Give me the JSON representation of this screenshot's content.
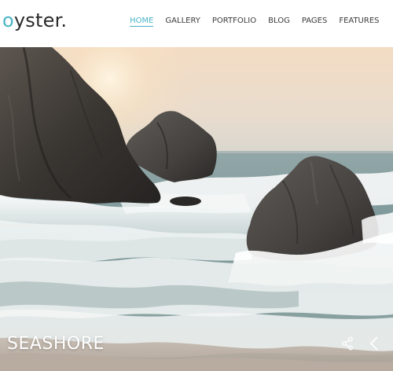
{
  "logo": {
    "first_letter": "o",
    "rest": "yster."
  },
  "colors": {
    "accent": "#49b4c6",
    "text": "#3b3b3b"
  },
  "nav": {
    "items": [
      {
        "label": "HOME",
        "active": true
      },
      {
        "label": "GALLERY",
        "active": false
      },
      {
        "label": "PORTFOLIO",
        "active": false
      },
      {
        "label": "BLOG",
        "active": false
      },
      {
        "label": "PAGES",
        "active": false
      },
      {
        "label": "FEATURES",
        "active": false
      }
    ]
  },
  "hero": {
    "caption": "SEASHORE",
    "icons": {
      "share": "share-icon",
      "prev": "chevron-left-icon"
    }
  }
}
